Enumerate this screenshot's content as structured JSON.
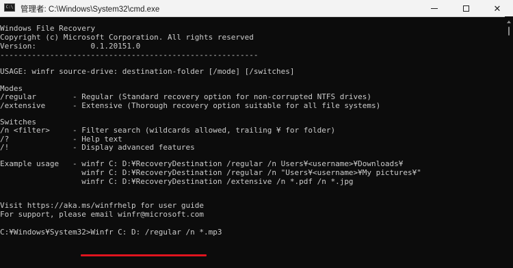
{
  "window": {
    "icon_label": "C:\\",
    "title": "管理者: C:\\Windows\\System32\\cmd.exe",
    "controls": {
      "minimize": "minimize",
      "maximize": "maximize",
      "close": "✕"
    }
  },
  "console": {
    "lines": [
      "Windows File Recovery",
      "Copyright (c) Microsoft Corporation. All rights reserved",
      "Version:            0.1.20151.0",
      "---------------------------------------------------------",
      "",
      "USAGE: winfr source-drive: destination-folder [/mode] [/switches]",
      "",
      "Modes",
      "/regular        - Regular (Standard recovery option for non-corrupted NTFS drives)",
      "/extensive      - Extensive (Thorough recovery option suitable for all file systems)",
      "",
      "Switches",
      "/n <filter>     - Filter search (wildcards allowed, trailing ¥ for folder)",
      "/?              - Help text",
      "/!              - Display advanced features",
      "",
      "Example usage   - winfr C: D:¥RecoveryDestination /regular /n Users¥<username>¥Downloads¥",
      "                  winfr C: D:¥RecoveryDestination /regular /n \"Users¥<username>¥My pictures¥\"",
      "                  winfr C: D:¥RecoveryDestination /extensive /n *.pdf /n *.jpg",
      "",
      "",
      "Visit https://aka.ms/winfrhelp for user guide",
      "For support, please email winfr@microsoft.com",
      "",
      "C:¥Windows¥System32>Winfr C: D: /regular /n *.mp3"
    ]
  },
  "annotation": {
    "underline_color": "#e0141e"
  },
  "colors": {
    "background": "#0c0c0c",
    "text": "#cccccc"
  }
}
